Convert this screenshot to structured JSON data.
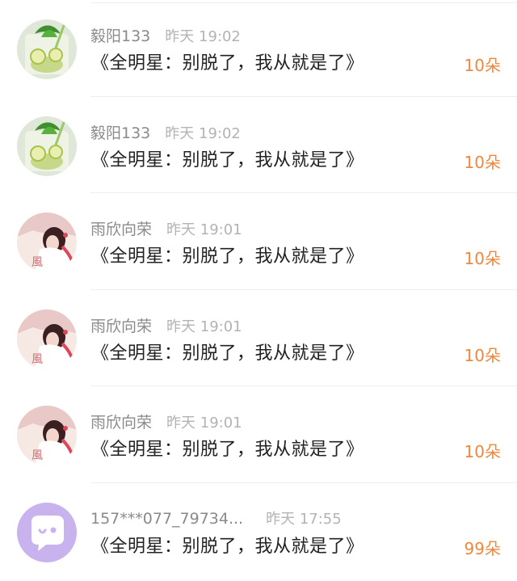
{
  "gifts": [
    {
      "username": "毅阳133",
      "time": "昨天 19:02",
      "message": "《全明星：别脱了，我从就是了》",
      "count": "10朵",
      "avatar": "drink-avatar"
    },
    {
      "username": "毅阳133",
      "time": "昨天 19:02",
      "message": "《全明星：别脱了，我从就是了》",
      "count": "10朵",
      "avatar": "drink-avatar"
    },
    {
      "username": "雨欣向荣",
      "time": "昨天 19:01",
      "message": "《全明星：别脱了，我从就是了》",
      "count": "10朵",
      "avatar": "portrait-avatar"
    },
    {
      "username": "雨欣向荣",
      "time": "昨天 19:01",
      "message": "《全明星：别脱了，我从就是了》",
      "count": "10朵",
      "avatar": "portrait-avatar"
    },
    {
      "username": "雨欣向荣",
      "time": "昨天 19:01",
      "message": "《全明星：别脱了，我从就是了》",
      "count": "10朵",
      "avatar": "portrait-avatar"
    },
    {
      "username": "157***077_79734...",
      "time": "昨天 17:55",
      "message": "《全明星：别脱了，我从就是了》",
      "count": "99朵",
      "avatar": "default-chat-avatar"
    }
  ],
  "colors": {
    "count": "#f0873a",
    "username": "#8a8a8a",
    "time": "#b3b3b3",
    "default_avatar": "#c9b3ee"
  }
}
